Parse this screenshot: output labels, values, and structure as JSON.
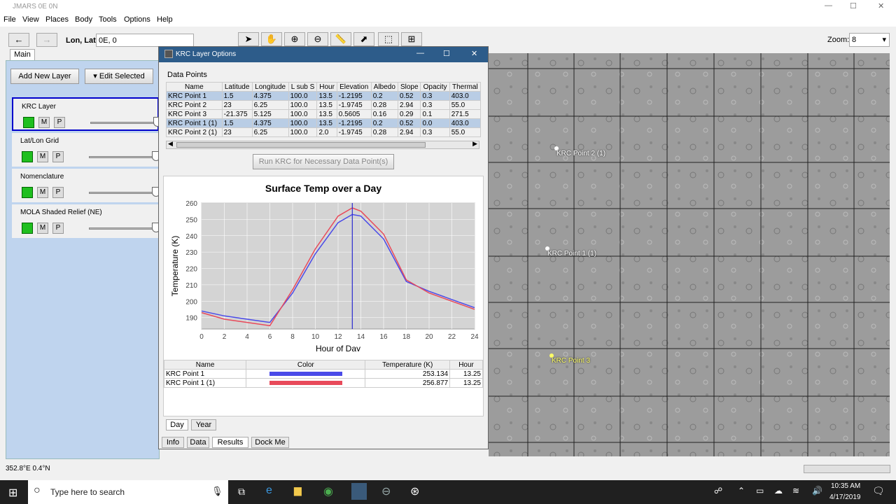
{
  "window": {
    "title": "JMARS 0E 0N"
  },
  "menu": [
    "File",
    "View",
    "Places",
    "Body",
    "Tools",
    "Options",
    "Help"
  ],
  "toolbar": {
    "lonlat_label": "Lon, Lat",
    "lonlat_value": "0E, 0",
    "zoom_label": "Zoom:",
    "zoom_value": "8"
  },
  "left": {
    "tab": "Main",
    "add_layer": "Add New Layer",
    "edit_selected": "Edit Selected",
    "layers": [
      {
        "name": "KRC Layer",
        "m": "M",
        "p": "P"
      },
      {
        "name": "Lat/Lon Grid",
        "m": "M",
        "p": "P"
      },
      {
        "name": "Nomenclature",
        "m": "M",
        "p": "P"
      },
      {
        "name": "MOLA Shaded Relief (NE)",
        "m": "M",
        "p": "P"
      }
    ]
  },
  "dialog": {
    "title": "KRC Layer Options",
    "section": "Data Points",
    "columns": [
      "Name",
      "Latitude",
      "Longitude",
      "L sub S",
      "Hour",
      "Elevation",
      "Albedo",
      "Slope",
      "Opacity",
      "Thermal"
    ],
    "rows": [
      [
        "KRC Point 1",
        "1.5",
        "4.375",
        "100.0",
        "13.5",
        "-1.2195",
        "0.2",
        "0.52",
        "0.3",
        "403.0"
      ],
      [
        "KRC Point 2",
        "23",
        "6.25",
        "100.0",
        "13.5",
        "-1.9745",
        "0.28",
        "2.94",
        "0.3",
        "55.0"
      ],
      [
        "KRC Point 3",
        "-21.375",
        "5.125",
        "100.0",
        "13.5",
        "0.5605",
        "0.16",
        "0.29",
        "0.1",
        "271.5"
      ],
      [
        "KRC Point 1 (1)",
        "1.5",
        "4.375",
        "100.0",
        "13.5",
        "-1.2195",
        "0.2",
        "0.52",
        "0.0",
        "403.0"
      ],
      [
        "KRC Point 2 (1)",
        "23",
        "6.25",
        "100.0",
        "2.0",
        "-1.9745",
        "0.28",
        "2.94",
        "0.3",
        "55.0"
      ]
    ],
    "run_button": "Run KRC for Necessary Data Point(s)",
    "legend_columns": [
      "Name",
      "Color",
      "Temperature (K)",
      "Hour"
    ],
    "legend_rows": [
      {
        "name": "KRC Point 1",
        "color": "#4a4ae8",
        "temp": "253.134",
        "hour": "13.25"
      },
      {
        "name": "KRC Point 1 (1)",
        "color": "#e84a5a",
        "temp": "256.877",
        "hour": "13.25"
      }
    ],
    "inner_tabs": [
      "Day",
      "Year"
    ],
    "bottom_tabs": [
      "Info",
      "Data",
      "Results",
      "Dock Me"
    ]
  },
  "chart_data": {
    "type": "line",
    "title": "Surface Temp over a Day",
    "xlabel": "Hour of Day",
    "ylabel": "Temperature (K)",
    "xlim": [
      0,
      24
    ],
    "ylim": [
      183,
      260
    ],
    "xticks": [
      "0",
      "2",
      "4",
      "6",
      "8",
      "10",
      "12",
      "14",
      "16",
      "18",
      "20",
      "22",
      "24"
    ],
    "yticks": [
      "190",
      "200",
      "210",
      "220",
      "230",
      "240",
      "250",
      "260"
    ],
    "marker_x": 13.25,
    "series": [
      {
        "color": "#4a4ae8",
        "x": [
          0,
          2,
          4,
          6,
          8,
          10,
          12,
          13.25,
          14,
          16,
          18,
          20,
          22,
          24
        ],
        "y": [
          194,
          191,
          189,
          187,
          205,
          229,
          248,
          253,
          252,
          238,
          212,
          206,
          201,
          196
        ]
      },
      {
        "color": "#e84a5a",
        "x": [
          0,
          2,
          4,
          6,
          8,
          10,
          12,
          13.25,
          14,
          16,
          18,
          20,
          22,
          24
        ],
        "y": [
          193,
          189,
          187,
          185,
          207,
          232,
          252,
          257,
          255,
          241,
          213,
          205,
          200,
          195
        ]
      }
    ]
  },
  "map": {
    "labels": [
      {
        "text": "KRC Point 2 (1)",
        "color": "#ffffff"
      },
      {
        "text": "KRC Point 1 (1)",
        "color": "#ffffff"
      },
      {
        "text": "KRC Point 3",
        "color": "#ffff66"
      }
    ]
  },
  "status": {
    "coords": "352.8°E   0.4°N"
  },
  "taskbar": {
    "search": "Type here to search",
    "time": "10:35 AM",
    "date": "4/17/2019"
  }
}
